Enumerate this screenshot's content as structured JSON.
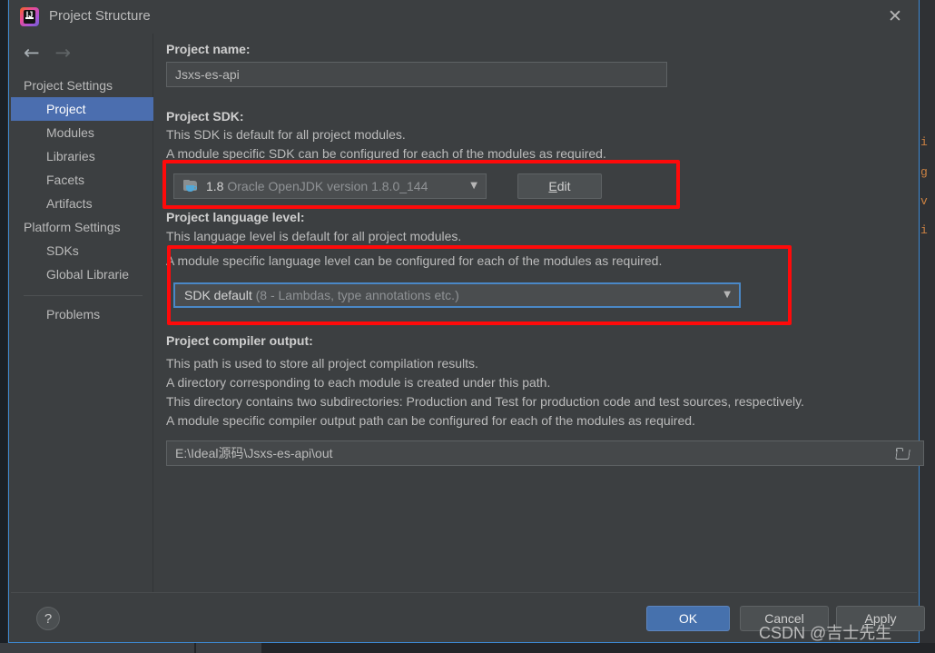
{
  "window": {
    "title": "Project Structure",
    "app_icon": "intellij-idea-icon",
    "close_icon": "✕"
  },
  "sidebar": {
    "back_icon": "←",
    "forward_icon": "→",
    "groups": [
      {
        "label": "Project Settings",
        "items": [
          {
            "label": "Project",
            "selected": true
          },
          {
            "label": "Modules",
            "selected": false
          },
          {
            "label": "Libraries",
            "selected": false
          },
          {
            "label": "Facets",
            "selected": false
          },
          {
            "label": "Artifacts",
            "selected": false
          }
        ]
      },
      {
        "label": "Platform Settings",
        "items": [
          {
            "label": "SDKs",
            "selected": false
          },
          {
            "label": "Global Librarie",
            "selected": false
          }
        ]
      }
    ],
    "extra_items": [
      {
        "label": "Problems",
        "selected": false
      }
    ]
  },
  "main": {
    "project_name": {
      "label": "Project name:",
      "value": "Jsxs-es-api"
    },
    "project_sdk": {
      "label": "Project SDK:",
      "description_lines": [
        "This SDK is default for all project modules.",
        "A module specific SDK can be configured for each of the modules as required."
      ],
      "icon": "jdk-icon",
      "value": "1.8",
      "value_detail": "Oracle OpenJDK version 1.8.0_144",
      "dropdown_icon": "▼",
      "edit_button": "Edit",
      "edit_button_mnemonic": "E"
    },
    "language_level": {
      "label": "Project language level:",
      "description_lines": [
        "This language level is default for all project modules.",
        "A module specific language level can be configured for each of the modules as required."
      ],
      "value": "SDK default",
      "value_detail": "(8 - Lambdas, type annotations etc.)",
      "dropdown_icon": "▼"
    },
    "compiler_output": {
      "label": "Project compiler output:",
      "description_lines": [
        "This path is used to store all project compilation results.",
        "A directory corresponding to each module is created under this path.",
        "This directory contains two subdirectories: Production and Test for production code and test sources, respectively.",
        "A module specific compiler output path can be configured for each of the modules as required."
      ],
      "value": "E:\\Ideal源码\\Jsxs-es-api\\out",
      "browse_icon": "folder-icon"
    }
  },
  "footer": {
    "help_label": "?",
    "ok_label": "OK",
    "cancel_label": "Cancel",
    "apply_label": "Apply",
    "apply_mnemonic": "A"
  },
  "annotations": [
    {
      "name": "sdk-highlight"
    },
    {
      "name": "language-level-highlight"
    }
  ],
  "watermark": {
    "text": "CSDN @吉士先生"
  },
  "background": {
    "code_fragments": [
      "i",
      "g",
      "v",
      "i"
    ]
  },
  "colors": {
    "accent": "#4b6eaf",
    "dialog_bg": "#3c3f41",
    "border_focus": "#3d8ad4",
    "annotation": "#ff0a0a",
    "ok_button": "#4671ad"
  }
}
